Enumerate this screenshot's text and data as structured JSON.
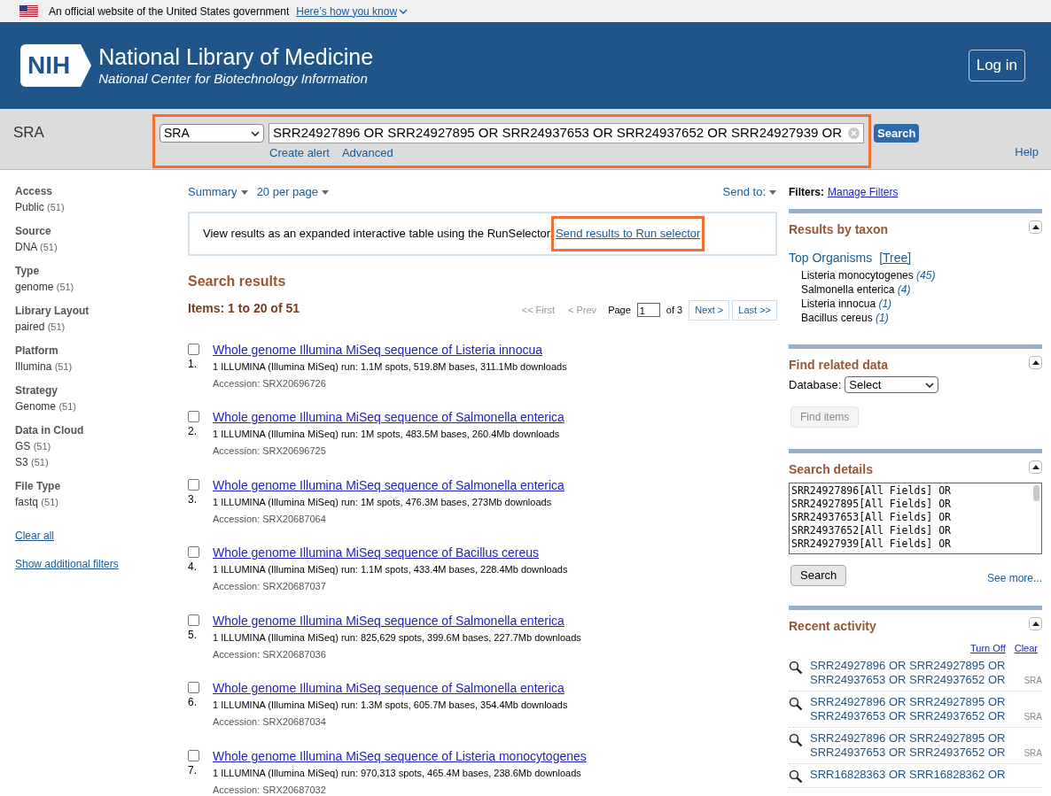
{
  "gov_banner": {
    "text": "An official website of the United States government",
    "link": "Here’s how you know"
  },
  "header": {
    "logo": "NIH",
    "title": "National Library of Medicine",
    "subtitle": "National Center for Biotechnology Information",
    "login": "Log in"
  },
  "search_bar": {
    "database_label": "SRA",
    "database_select": "SRA",
    "query": "SRR24927896 OR SRR24927895 OR SRR24937653 OR SRR24937652 OR SRR24927939 OR",
    "search_button": "Search",
    "links": [
      "Create alert",
      "Advanced"
    ],
    "help": "Help",
    "highlighted": true
  },
  "sidebar": {
    "groups": [
      {
        "title": "Access",
        "items": [
          {
            "label": "Public",
            "count": "(51)"
          }
        ]
      },
      {
        "title": "Source",
        "items": [
          {
            "label": "DNA",
            "count": "(51)"
          }
        ]
      },
      {
        "title": "Type",
        "items": [
          {
            "label": "genome",
            "count": "(51)"
          }
        ]
      },
      {
        "title": "Library Layout",
        "items": [
          {
            "label": "paired",
            "count": "(51)"
          }
        ]
      },
      {
        "title": "Platform",
        "items": [
          {
            "label": "Illumina",
            "count": "(51)"
          }
        ]
      },
      {
        "title": "Strategy",
        "items": [
          {
            "label": "Genome",
            "count": "(51)"
          }
        ]
      },
      {
        "title": "Data in Cloud",
        "items": [
          {
            "label": "GS",
            "count": "(51)"
          },
          {
            "label": "S3",
            "count": "(51)"
          }
        ]
      },
      {
        "title": "File Type",
        "items": [
          {
            "label": "fastq",
            "count": "(51)"
          }
        ]
      }
    ],
    "links": [
      "Clear all",
      "Show additional filters"
    ]
  },
  "toolbar": {
    "format": "Summary",
    "per_page": "20 per page",
    "send_to": "Send to:"
  },
  "run_selector": {
    "text": "View results as an expanded interactive table using the RunSelector.",
    "link": "Send results to Run selector",
    "highlighted": true
  },
  "results": {
    "title": "Search results",
    "count": "Items: 1 to 20 of 51",
    "pagination": {
      "first": {
        "label": "<< First",
        "disabled": true
      },
      "prev": {
        "label": "< Prev",
        "disabled": true
      },
      "page_label": "Page",
      "page": "1",
      "of": "of 3",
      "next": {
        "label": "Next >",
        "disabled": false
      },
      "last": {
        "label": "Last >>",
        "disabled": false
      }
    },
    "items": [
      {
        "number": "1.",
        "checked": false,
        "title": "Whole genome Illumina MiSeq sequence of Listeria innocua",
        "description": "1 ILLUMINA (Illumina MiSeq) run: 1.1M spots, 519.8M bases, 311.1Mb downloads",
        "accession": "Accession: SRX20696726"
      },
      {
        "number": "2.",
        "checked": false,
        "title": "Whole genome Illumina MiSeq sequence of Salmonella enterica",
        "description": "1 ILLUMINA (Illumina MiSeq) run: 1M spots, 483.5M bases, 260.4Mb downloads",
        "accession": "Accession: SRX20696725"
      },
      {
        "number": "3.",
        "checked": false,
        "title": "Whole genome Illumina MiSeq sequence of Salmonella enterica",
        "description": "1 ILLUMINA (Illumina MiSeq) run: 1M spots, 476.3M bases, 273Mb downloads",
        "accession": "Accession: SRX20687064"
      },
      {
        "number": "4.",
        "checked": false,
        "title": "Whole genome Illumina MiSeq sequence of Bacillus cereus",
        "description": "1 ILLUMINA (Illumina MiSeq) run: 1.1M spots, 433.4M bases, 228.4Mb downloads",
        "accession": "Accession: SRX20687037"
      },
      {
        "number": "5.",
        "checked": false,
        "title": "Whole genome Illumina MiSeq sequence of Salmonella enterica",
        "description": "1 ILLUMINA (Illumina MiSeq) run: 825,629 spots, 399.6M bases, 227.7Mb downloads",
        "accession": "Accession: SRX20687036"
      },
      {
        "number": "6.",
        "checked": false,
        "title": "Whole genome Illumina MiSeq sequence of Salmonella enterica",
        "description": "1 ILLUMINA (Illumina MiSeq) run: 1.3M spots, 605.7M bases, 354.4Mb downloads",
        "accession": "Accession: SRX20687034"
      },
      {
        "number": "7.",
        "checked": false,
        "title": "Whole genome Illumina MiSeq sequence of Listeria monocytogenes",
        "description": "1 ILLUMINA (Illumina MiSeq) run: 970,313 spots, 465.4M bases, 238.6Mb downloads",
        "accession": "Accession: SRX20687032"
      }
    ]
  },
  "right_panel": {
    "filters_label": "Filters:",
    "manage_filters": "Manage Filters",
    "taxon": {
      "title": "Results by taxon",
      "top_organisms": "Top Organisms",
      "tree": "[Tree]",
      "organisms": [
        {
          "name": "Listeria monocytogenes",
          "count": "(45)"
        },
        {
          "name": "Salmonella enterica",
          "count": "(4)"
        },
        {
          "name": "Listeria innocua",
          "count": "(1)"
        },
        {
          "name": "Bacillus cereus",
          "count": "(1)"
        }
      ]
    },
    "related": {
      "title": "Find related data",
      "database_label": "Database:",
      "select": "Select",
      "button": {
        "label": "Find items",
        "disabled": true
      }
    },
    "details": {
      "title": "Search details",
      "lines": [
        "SRR24927896[All Fields] OR",
        "SRR24927895[All Fields] OR",
        "SRR24937653[All Fields] OR",
        "SRR24937652[All Fields] OR",
        "SRR24927939[All Fields] OR"
      ],
      "button": "Search",
      "see_more": "See more..."
    },
    "recent": {
      "title": "Recent activity",
      "turn_off": "Turn Off",
      "clear": "Clear",
      "items": [
        {
          "query": "SRR24927896 OR SRR24927895 OR SRR24937653 OR SRR24937652 OR",
          "database": "SRA"
        },
        {
          "query": "SRR24927896 OR SRR24927895 OR SRR24937653 OR SRR24937652 OR",
          "database": "SRA"
        },
        {
          "query": "SRR24927896 OR SRR24927895 OR SRR24937653 OR SRR24937652 OR",
          "database": "SRA"
        },
        {
          "query": "SRR16828363 OR SRR16828362 OR"
        }
      ]
    }
  }
}
